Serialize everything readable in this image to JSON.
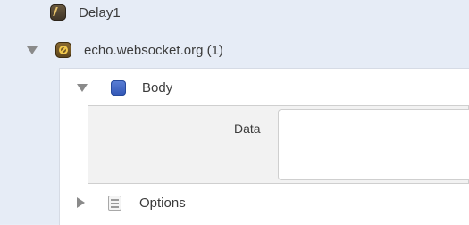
{
  "tree": {
    "delay_item": {
      "label": "Delay1",
      "icon": "delay-icon"
    },
    "websocket_item": {
      "label": "echo.websocket.org (1)",
      "icon": "websocket-icon",
      "expanded": true
    },
    "body_section": {
      "label": "Body",
      "icon": "body-icon",
      "expanded": true
    },
    "options_section": {
      "label": "Options",
      "icon": "options-icon",
      "expanded": false
    }
  },
  "body_form": {
    "data_label": "Data",
    "data_value": ""
  }
}
